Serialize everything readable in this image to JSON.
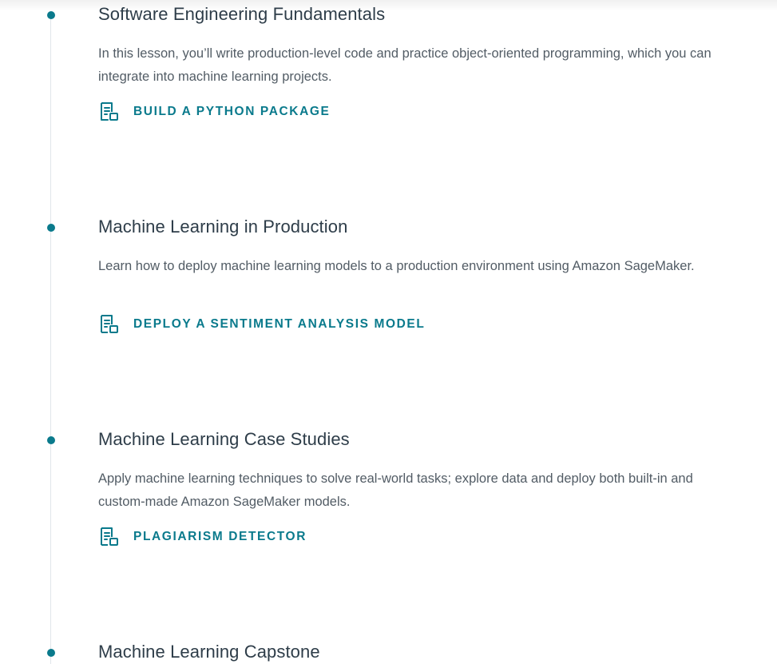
{
  "lessons": [
    {
      "title": "Software Engineering Fundamentals",
      "description": "In this lesson, you’ll write production-level code and practice object-oriented programming, which you can integrate into machine learning projects.",
      "project": "BUILD A PYTHON PACKAGE"
    },
    {
      "title": "Machine Learning in Production",
      "description": "Learn how to deploy machine learning models to a production environment using Amazon SageMaker.",
      "project": "DEPLOY A SENTIMENT ANALYSIS MODEL"
    },
    {
      "title": "Machine Learning Case Studies",
      "description": "Apply machine learning techniques to solve real-world tasks; explore data and deploy both built-in and custom-made Amazon SageMaker models.",
      "project": "PLAGIARISM DETECTOR"
    },
    {
      "title": "Machine Learning Capstone"
    }
  ],
  "icons": {
    "project": "project-document-icon",
    "timeline_dot": "timeline-dot-icon"
  },
  "colors": {
    "accent": "#0a7a8c",
    "title_text": "#2e3d49",
    "body_text": "#525c65",
    "timeline_line": "#e1e6ea"
  }
}
